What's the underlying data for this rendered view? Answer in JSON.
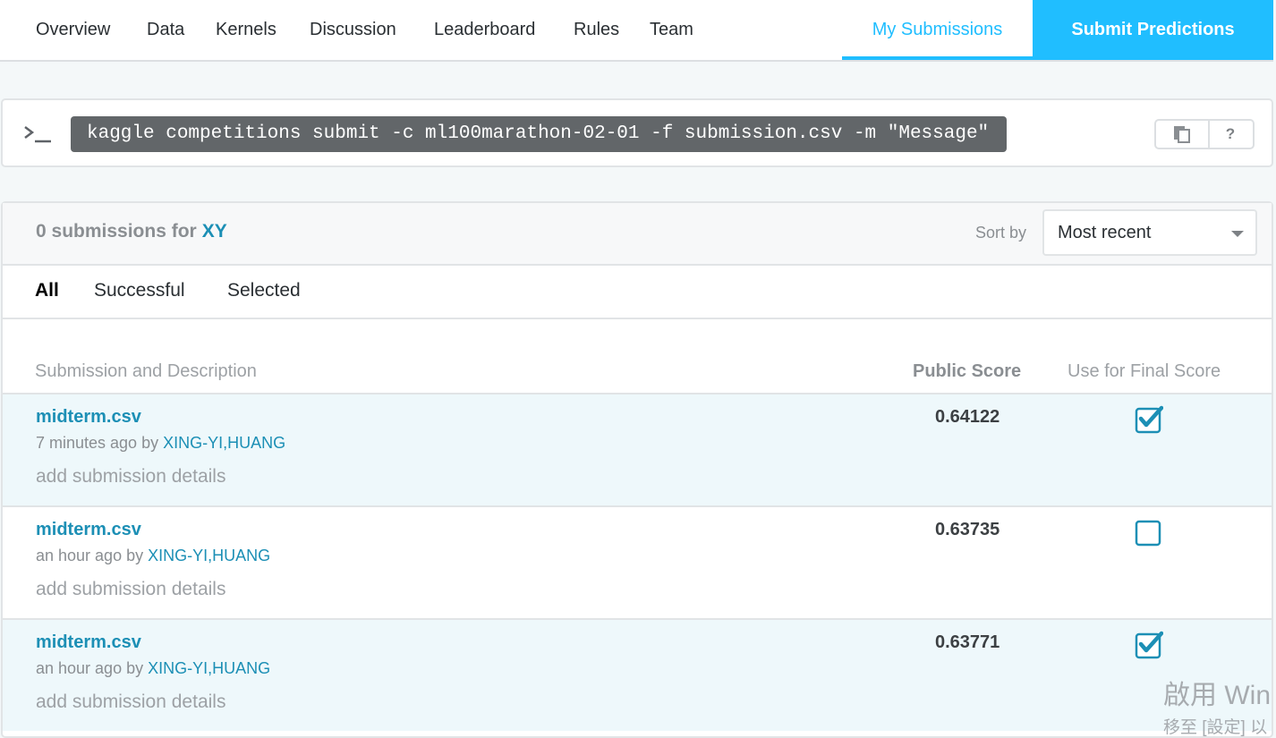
{
  "nav": {
    "tabs": [
      "Overview",
      "Data",
      "Kernels",
      "Discussion",
      "Leaderboard",
      "Rules",
      "Team"
    ],
    "my_submissions": "My Submissions",
    "submit_predictions": "Submit Predictions"
  },
  "api": {
    "command": "kaggle competitions submit -c ml100marathon-02-01 -f submission.csv -m \"Message\"",
    "help_label": "?"
  },
  "submissions": {
    "count_text": "0 submissions for",
    "team": "XY",
    "sort_label": "Sort by",
    "sort_value": "Most recent",
    "filters": [
      "All",
      "Successful",
      "Selected"
    ],
    "columns": {
      "description": "Submission and Description",
      "public_score": "Public Score",
      "final": "Use for Final Score"
    },
    "rows": [
      {
        "file": "midterm.csv",
        "time": "7 minutes ago by",
        "user": "XING-YI,HUANG",
        "details": "add submission details",
        "score": "0.64122",
        "selected": true
      },
      {
        "file": "midterm.csv",
        "time": "an hour ago by",
        "user": "XING-YI,HUANG",
        "details": "add submission details",
        "score": "0.63735",
        "selected": false
      },
      {
        "file": "midterm.csv",
        "time": "an hour ago by",
        "user": "XING-YI,HUANG",
        "details": "add submission details",
        "score": "0.63771",
        "selected": true
      }
    ]
  },
  "watermark": {
    "line1": "啟用 Win",
    "line2": "移至 [設定] 以"
  },
  "colors": {
    "accent": "#20beff",
    "link": "#1c8fb5",
    "row_highlight": "#eef8fb"
  }
}
